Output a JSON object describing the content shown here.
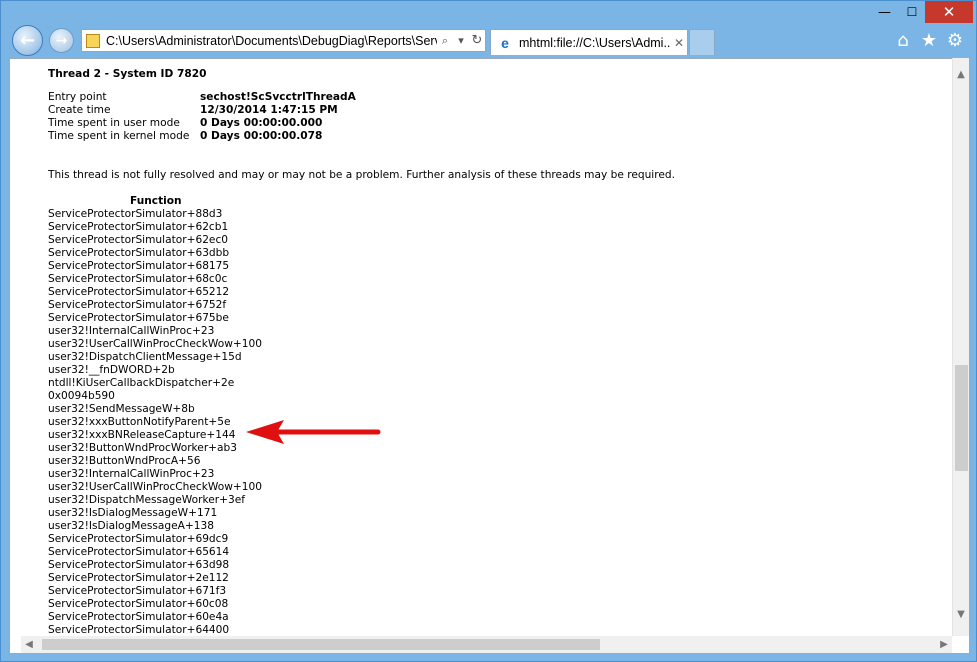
{
  "window": {
    "caption_min": "—",
    "caption_max": "☐",
    "caption_close": "✕"
  },
  "nav": {
    "back_glyph": "←",
    "forward_glyph": "→"
  },
  "address_bar": {
    "url": "C:\\Users\\Administrator\\Documents\\DebugDiag\\Reports\\Serv",
    "search_glyph": "⌕",
    "dropdown_glyph": "▾",
    "refresh_glyph": "↻"
  },
  "tab": {
    "title": "mhtml:file://C:\\Users\\Admi...",
    "close_glyph": "✕",
    "icon_glyph": "e"
  },
  "toolbar_icons": {
    "home": "⌂",
    "favorites": "★",
    "tools": "⚙"
  },
  "report": {
    "thread_title": "Thread 2 - System ID 7820",
    "info": [
      {
        "label": "Entry point",
        "value": "sechost!ScSvcctrlThreadA"
      },
      {
        "label": "Create time",
        "value": "12/30/2014 1:47:15 PM"
      },
      {
        "label": "Time spent in user mode",
        "value": "0 Days 00:00:00.000"
      },
      {
        "label": "Time spent in kernel mode",
        "value": "0 Days 00:00:00.078"
      }
    ],
    "note": "This thread is not fully resolved and may or may not be a problem. Further analysis of these threads may be required.",
    "function_header": "Function",
    "functions": [
      "ServiceProtectorSimulator+88d3",
      "ServiceProtectorSimulator+62cb1",
      "ServiceProtectorSimulator+62ec0",
      "ServiceProtectorSimulator+63dbb",
      "ServiceProtectorSimulator+68175",
      "ServiceProtectorSimulator+68c0c",
      "ServiceProtectorSimulator+65212",
      "ServiceProtectorSimulator+6752f",
      "ServiceProtectorSimulator+675be",
      "user32!InternalCallWinProc+23",
      "user32!UserCallWinProcCheckWow+100",
      "user32!DispatchClientMessage+15d",
      "user32!__fnDWORD+2b",
      "ntdll!KiUserCallbackDispatcher+2e",
      "0x0094b590",
      "user32!SendMessageW+8b",
      "user32!xxxButtonNotifyParent+5e",
      "user32!xxxBNReleaseCapture+144",
      "user32!ButtonWndProcWorker+ab3",
      "user32!ButtonWndProcA+56",
      "user32!InternalCallWinProc+23",
      "user32!UserCallWinProcCheckWow+100",
      "user32!DispatchMessageWorker+3ef",
      "user32!IsDialogMessageW+171",
      "user32!IsDialogMessageA+138",
      "ServiceProtectorSimulator+69dc9",
      "ServiceProtectorSimulator+65614",
      "ServiceProtectorSimulator+63d98",
      "ServiceProtectorSimulator+2e112",
      "ServiceProtectorSimulator+671f3",
      "ServiceProtectorSimulator+60c08",
      "ServiceProtectorSimulator+60e4a",
      "ServiceProtectorSimulator+64400"
    ]
  },
  "scrollbars": {
    "up": "▲",
    "down": "▼",
    "left": "◀",
    "right": "▶"
  },
  "colors": {
    "frame": "#7bb5e6",
    "close_button": "#c7382c",
    "annotation_arrow": "#e01010"
  }
}
